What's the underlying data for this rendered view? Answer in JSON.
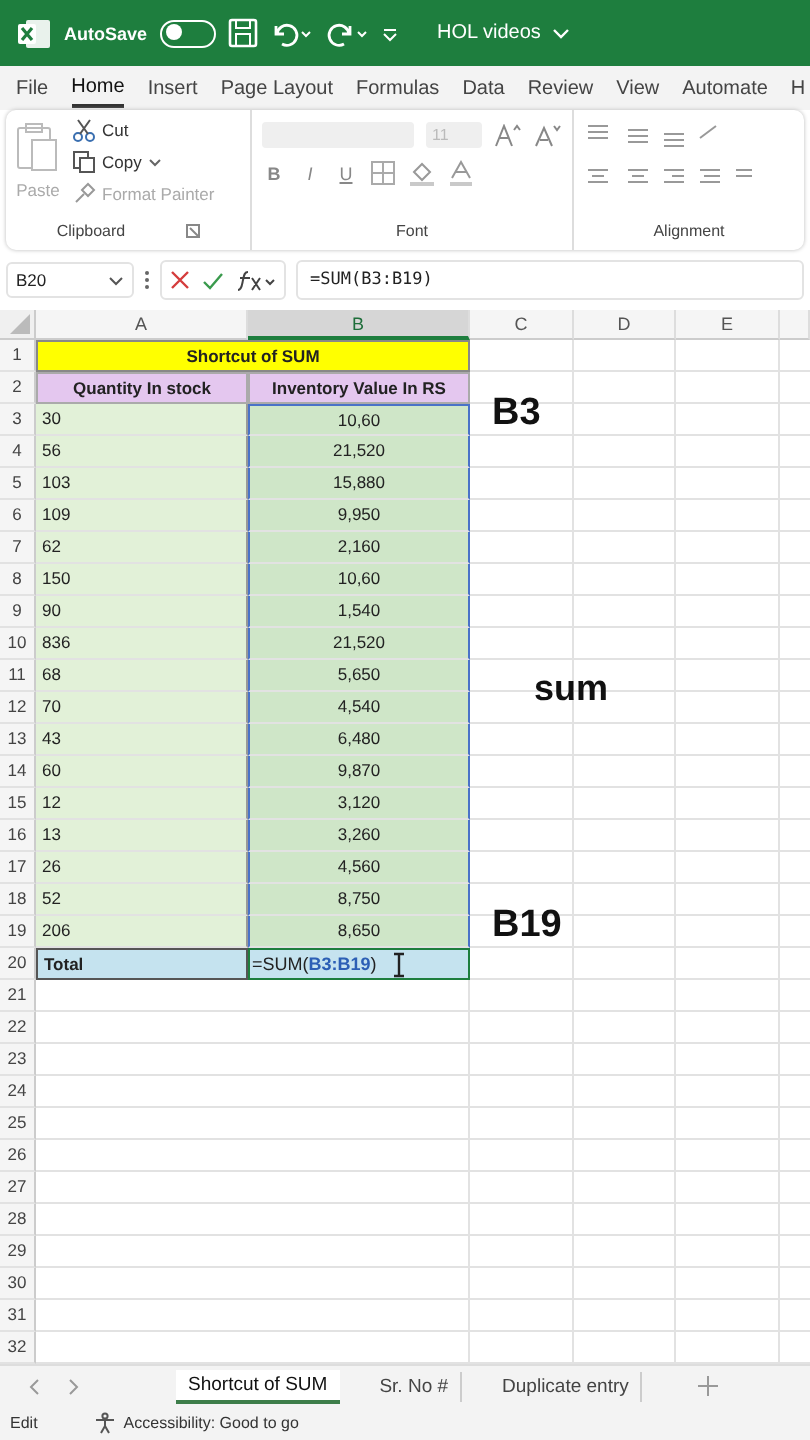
{
  "title_bar": {
    "autosave_label": "AutoSave",
    "autosave_on": false,
    "document": "HOL videos"
  },
  "menu_tabs": [
    {
      "label": "File",
      "selected": false
    },
    {
      "label": "Home",
      "selected": true
    },
    {
      "label": "Insert",
      "selected": false
    },
    {
      "label": "Page Layout",
      "selected": false
    },
    {
      "label": "Formulas",
      "selected": false
    },
    {
      "label": "Data",
      "selected": false
    },
    {
      "label": "Review",
      "selected": false
    },
    {
      "label": "View",
      "selected": false
    },
    {
      "label": "Automate",
      "selected": false
    },
    {
      "label": "H",
      "selected": false
    }
  ],
  "ribbon": {
    "clipboard": {
      "paste": {
        "label": "Paste",
        "disabled": true
      },
      "cut": {
        "label": "Cut",
        "disabled": false
      },
      "copy": {
        "label": "Copy",
        "disabled": false
      },
      "format_painter": {
        "label": "Format Painter",
        "disabled": true
      },
      "label": "Clipboard"
    },
    "font": {
      "size": "11",
      "bold": "B",
      "italic": "I",
      "underline": "U",
      "label": "Font"
    },
    "alignment": {
      "label": "Alignment"
    }
  },
  "formula_bar": {
    "name_box": "B20",
    "formula": "=SUM(B3:B19)"
  },
  "columns": [
    {
      "label": "A",
      "selected": false
    },
    {
      "label": "B",
      "selected": true
    },
    {
      "label": "C",
      "selected": false
    },
    {
      "label": "D",
      "selected": false
    },
    {
      "label": "E",
      "selected": false
    }
  ],
  "rows": [
    {
      "number": "1",
      "kind": "title",
      "text": "Shortcut of SUM"
    },
    {
      "number": "2",
      "kind": "header",
      "a": "Quantity In stock",
      "b": "Inventory Value In RS"
    },
    {
      "number": "3",
      "kind": "data",
      "a": "30",
      "b": "10,60"
    },
    {
      "number": "4",
      "kind": "data",
      "a": "56",
      "b": "21,520"
    },
    {
      "number": "5",
      "kind": "data",
      "a": "103",
      "b": "15,880"
    },
    {
      "number": "6",
      "kind": "data",
      "a": "109",
      "b": "9,950"
    },
    {
      "number": "7",
      "kind": "data",
      "a": "62",
      "b": "2,160"
    },
    {
      "number": "8",
      "kind": "data",
      "a": "150",
      "b": "10,60"
    },
    {
      "number": "9",
      "kind": "data",
      "a": "90",
      "b": "1,540"
    },
    {
      "number": "10",
      "kind": "data",
      "a": "836",
      "b": "21,520"
    },
    {
      "number": "11",
      "kind": "data",
      "a": "68",
      "b": "5,650"
    },
    {
      "number": "12",
      "kind": "data",
      "a": "70",
      "b": "4,540"
    },
    {
      "number": "13",
      "kind": "data",
      "a": "43",
      "b": "6,480"
    },
    {
      "number": "14",
      "kind": "data",
      "a": "60",
      "b": "9,870"
    },
    {
      "number": "15",
      "kind": "data",
      "a": "12",
      "b": "3,120"
    },
    {
      "number": "16",
      "kind": "data",
      "a": "13",
      "b": "3,260"
    },
    {
      "number": "17",
      "kind": "data",
      "a": "26",
      "b": "4,560"
    },
    {
      "number": "18",
      "kind": "data",
      "a": "52",
      "b": "8,750"
    },
    {
      "number": "19",
      "kind": "data",
      "a": "206",
      "b": "8,650"
    },
    {
      "number": "20",
      "kind": "total",
      "a": "Total",
      "b_prefix": "=SUM(",
      "b_ref": "B3:B19",
      "b_suffix": ")"
    },
    {
      "number": "21",
      "kind": "empty"
    },
    {
      "number": "22",
      "kind": "empty"
    },
    {
      "number": "23",
      "kind": "empty"
    },
    {
      "number": "24",
      "kind": "empty"
    },
    {
      "number": "25",
      "kind": "empty"
    },
    {
      "number": "26",
      "kind": "empty"
    },
    {
      "number": "27",
      "kind": "empty"
    },
    {
      "number": "28",
      "kind": "empty"
    },
    {
      "number": "29",
      "kind": "empty"
    },
    {
      "number": "30",
      "kind": "empty"
    },
    {
      "number": "31",
      "kind": "empty"
    },
    {
      "number": "32",
      "kind": "empty"
    }
  ],
  "annotations": [
    {
      "text": "B3",
      "kind": "top"
    },
    {
      "text": "sum",
      "kind": "middle"
    },
    {
      "text": "B19",
      "kind": "bottom"
    }
  ],
  "sheet_tabs": [
    {
      "label": "Shortcut of SUM",
      "selected": true
    },
    {
      "label": "Sr. No #",
      "selected": false
    },
    {
      "label": "Duplicate entry",
      "selected": false
    }
  ],
  "status_bar": {
    "mode": "Edit",
    "accessibility": "Accessibility: Good to go"
  }
}
